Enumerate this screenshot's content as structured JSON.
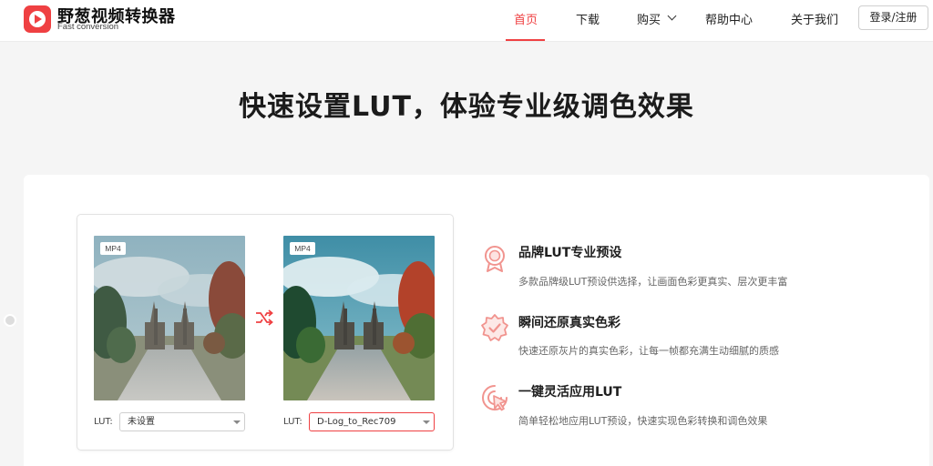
{
  "brand": {
    "name": "野葱视频转换器",
    "subtitle": "Fast conversion",
    "color": "#ef4042"
  },
  "nav": {
    "items": [
      {
        "label": "首页",
        "active": true
      },
      {
        "label": "下载"
      },
      {
        "label": "购买"
      },
      {
        "label": "帮助中心"
      },
      {
        "label": "关于我们"
      }
    ],
    "login_label": "登录/注册"
  },
  "hero": {
    "title": "快速设置LUT，体验专业级调色效果"
  },
  "compare": {
    "left": {
      "format": "MP4",
      "lut_label": "LUT:",
      "lut_value": "未设置"
    },
    "right": {
      "format": "MP4",
      "lut_label": "LUT:",
      "lut_value": "D-Log_to_Rec709"
    },
    "swap_icon": "shuffle-icon"
  },
  "features": [
    {
      "icon": "award-badge-icon",
      "title": "品牌LUT专业预设",
      "desc": "多款品牌级LUT预设供选择，让画面色彩更真实、层次更丰富"
    },
    {
      "icon": "verified-star-icon",
      "title": "瞬间还原真实色彩",
      "desc": "快速还原灰片的真实色彩，让每一帧都充满生动细腻的质感"
    },
    {
      "icon": "pointer-click-icon",
      "title": "一键灵活应用LUT",
      "desc": "简单轻松地应用LUT预设，快速实现色彩转换和调色效果"
    }
  ]
}
